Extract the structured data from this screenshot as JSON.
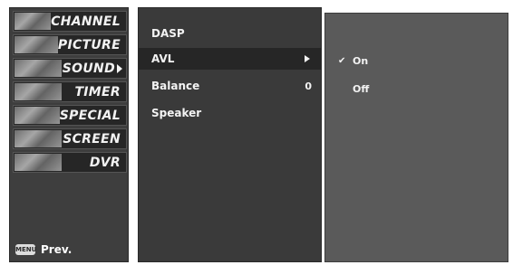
{
  "left_menu": {
    "items": [
      {
        "label": "CHANNEL"
      },
      {
        "label": "PICTURE"
      },
      {
        "label": "SOUND"
      },
      {
        "label": "TIMER"
      },
      {
        "label": "SPECIAL"
      },
      {
        "label": "SCREEN"
      },
      {
        "label": "DVR"
      }
    ],
    "selected_index": 2,
    "footer": {
      "key_label": "MENU",
      "prev_label": "Prev."
    }
  },
  "sound_menu": {
    "items": [
      {
        "label": "DASP",
        "value": ""
      },
      {
        "label": "AVL",
        "value": ""
      },
      {
        "label": "Balance",
        "value": "0"
      },
      {
        "label": "Speaker",
        "value": ""
      }
    ],
    "highlighted_index": 1
  },
  "avl_options": {
    "items": [
      {
        "label": "On",
        "checked": true
      },
      {
        "label": "Off",
        "checked": false
      }
    ],
    "check_glyph": "✔"
  },
  "colors": {
    "menu_bg": "#3e3e3e",
    "item_bg": "#262626",
    "panel_bg": "#5a5a5a",
    "text": "#f3f3f3"
  }
}
